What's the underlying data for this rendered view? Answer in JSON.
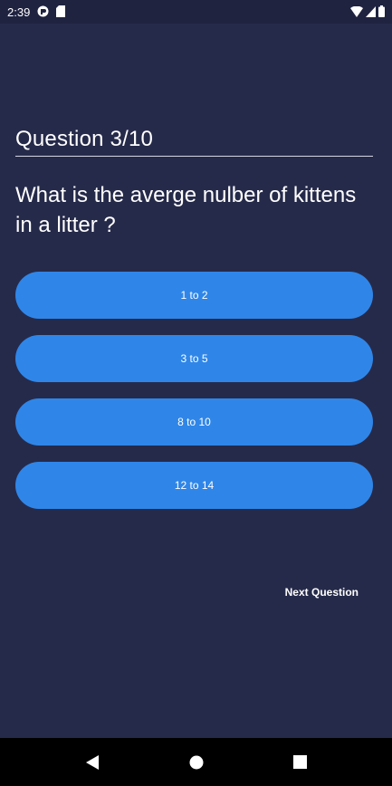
{
  "status_bar": {
    "time": "2:39",
    "icons": [
      "sync-icon",
      "sd-card-icon",
      "wifi-icon",
      "signal-icon",
      "battery-icon"
    ]
  },
  "quiz": {
    "counter": "Question 3/10",
    "question": "What is the averge nulber of kittens in a litter ?",
    "answers": [
      {
        "label": "1 to 2"
      },
      {
        "label": "3 to 5"
      },
      {
        "label": "8 to 10"
      },
      {
        "label": "12 to 14"
      }
    ],
    "next_label": "Next Question"
  },
  "nav_bar": {
    "icons": [
      "back-icon",
      "home-icon",
      "recents-icon"
    ]
  },
  "colors": {
    "background": "#262a4a",
    "button": "#2f86e8",
    "text": "#ffffff"
  }
}
